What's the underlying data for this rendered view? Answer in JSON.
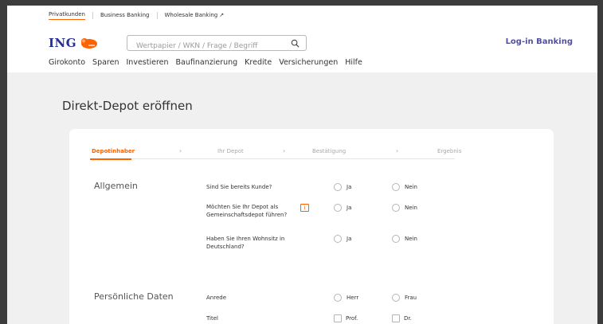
{
  "topbar": {
    "items": [
      "Privatkunden",
      "Business Banking",
      "Wholesale Banking"
    ],
    "external_icon": "↗"
  },
  "header": {
    "logo_text": "ING",
    "search_placeholder": "Wertpapier / WKN / Frage / Begriff",
    "login_label": "Log-in Banking"
  },
  "nav": {
    "items": [
      "Girokonto",
      "Sparen",
      "Investieren",
      "Baufinanzierung",
      "Kredite",
      "Versicherungen",
      "Hilfe"
    ]
  },
  "page": {
    "title": "Direkt-Depot eröffnen"
  },
  "steps": {
    "items": [
      "Depotinhaber",
      "Ihr Depot",
      "Bestätigung",
      "Ergebnis"
    ],
    "separator": "›"
  },
  "form": {
    "section_general": "Allgemein",
    "q_customer": "Sind Sie bereits Kunde?",
    "q_joint": "Möchten Sie Ihr Depot als Gemeinschaftsdepot führen?",
    "info_label": "i",
    "q_residence": "Haben Sie Ihren Wohnsitz in Deutschland?",
    "yes": "Ja",
    "no": "Nein",
    "section_personal": "Persönliche Daten",
    "q_salutation": "Anrede",
    "opt_mr": "Herr",
    "opt_mrs": "Frau",
    "q_title": "Titel",
    "opt_prof": "Prof.",
    "opt_dr": "Dr."
  },
  "colors": {
    "accent": "#ff6200",
    "brand": "#262f96",
    "background": "#f0f0f0"
  }
}
